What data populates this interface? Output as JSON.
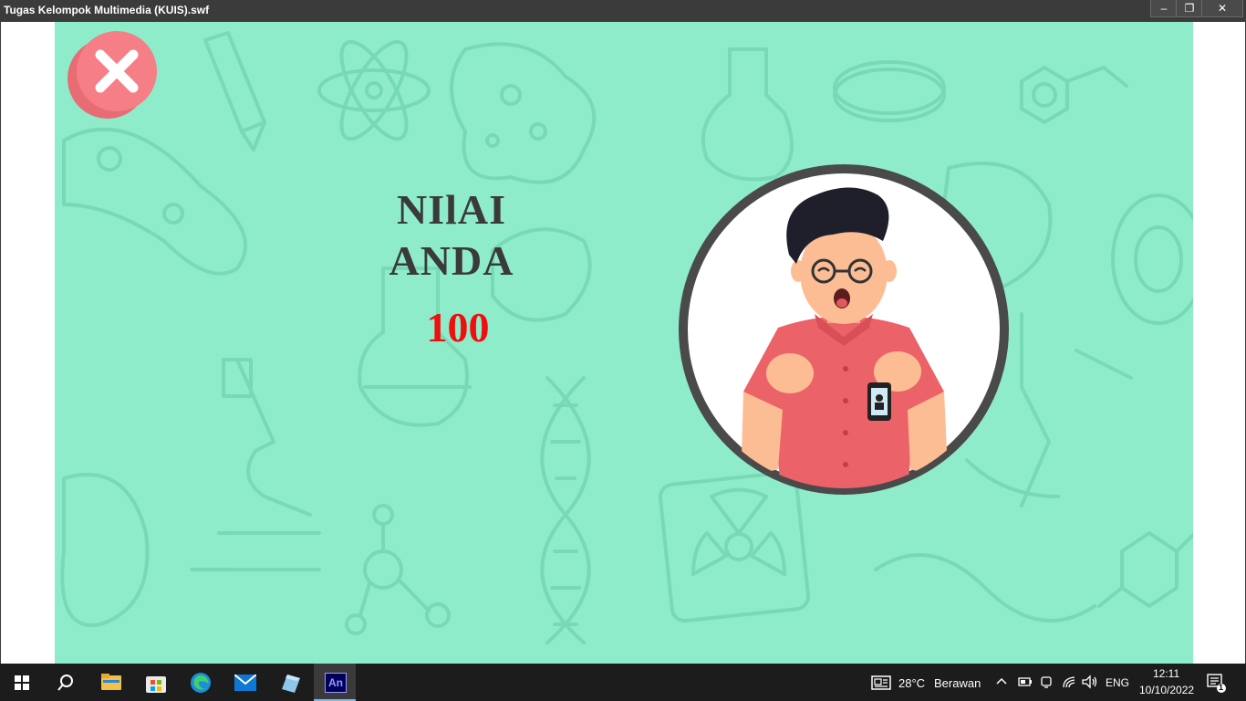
{
  "window": {
    "title": "Tugas Kelompok Multimedia (KUIS).swf",
    "controls": {
      "minimize": "‒",
      "restore": "❐",
      "close": "✕"
    }
  },
  "quiz_result": {
    "heading": "NIlAI\nANDA",
    "score": "100",
    "colors": {
      "background": "#8eeccb",
      "heading": "#3a3a3a",
      "score": "#ee0f0f",
      "close_button": "#f67e86"
    }
  },
  "icons": {
    "close": "close-x-icon",
    "avatar": "happy-student-illustration"
  },
  "taskbar": {
    "apps": [
      "start-icon",
      "search-icon",
      "file-explorer-icon",
      "microsoft-store-icon",
      "edge-icon",
      "mail-icon",
      "app-icon",
      "animate-icon"
    ],
    "animate_label": "An",
    "weather": {
      "temp": "28°C",
      "condition": "Berawan"
    },
    "language": "ENG",
    "time": "12:11",
    "date": "10/10/2022",
    "notification_count": "1"
  }
}
